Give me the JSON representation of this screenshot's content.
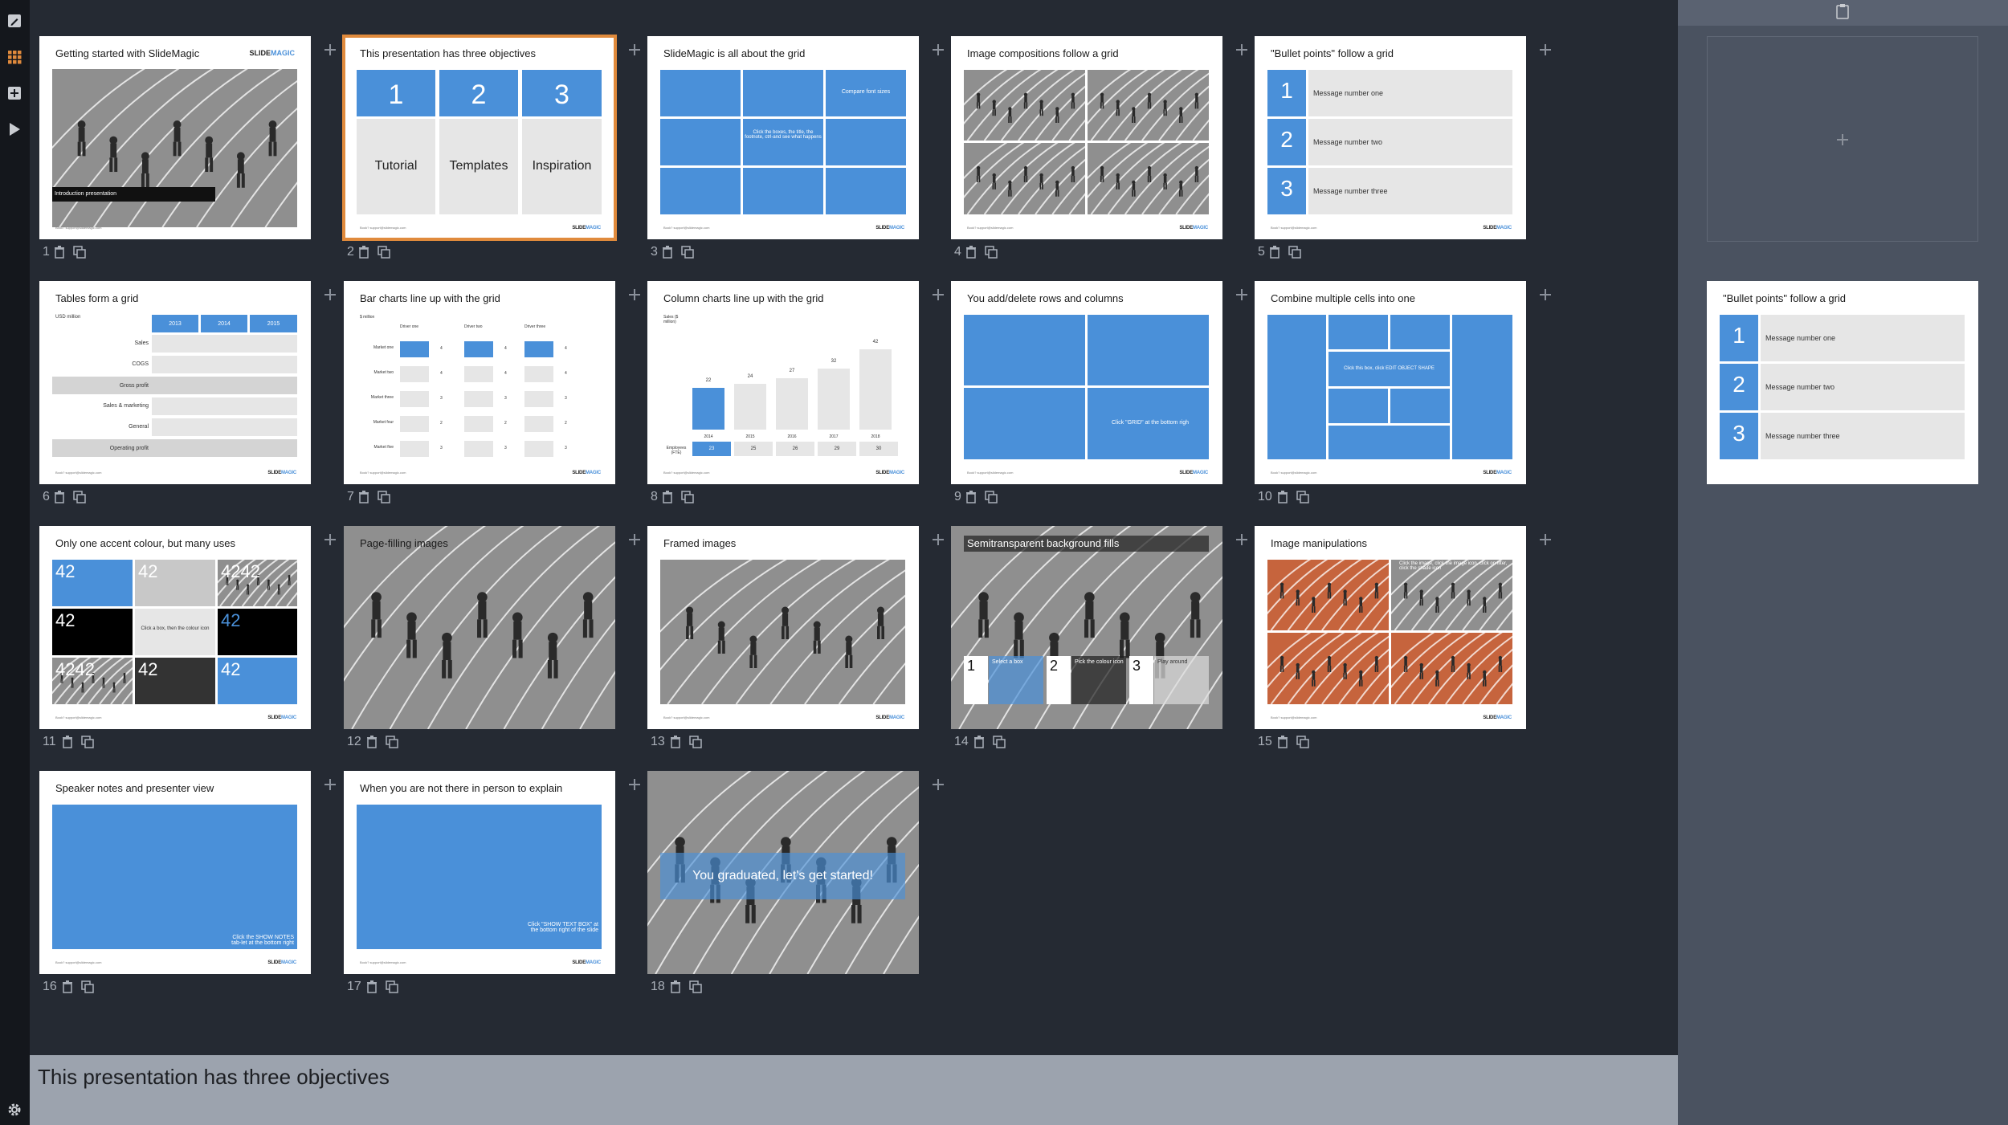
{
  "app": {
    "brand_prefix": "SLIDE",
    "brand_suffix": "MAGIC",
    "footer": "Book? support@slidemagic.com"
  },
  "colors": {
    "accent": "#4a90d9",
    "selected": "#e08a3c",
    "background": "#252a33"
  },
  "sidebar": {
    "items": [
      {
        "icon": "edit-icon"
      },
      {
        "icon": "grid-view-icon"
      },
      {
        "icon": "add-slide-icon"
      },
      {
        "icon": "play-icon"
      }
    ],
    "bottom": {
      "icon": "settings-icon"
    }
  },
  "slides": [
    {
      "number": "1",
      "title": "Getting started with SlideMagic",
      "caption": "Introduction presentation"
    },
    {
      "number": "2",
      "title": "This presentation has three objectives",
      "n1": "1",
      "n2": "2",
      "n3": "3",
      "l1": "Tutorial",
      "l2": "Templates",
      "l3": "Inspiration"
    },
    {
      "number": "3",
      "title": "SlideMagic is all about the grid",
      "t1": "Compare font sizes",
      "t2": "Click the boxes, the title, the footnote, ctrl-and see what happens"
    },
    {
      "number": "4",
      "title": "Image compositions follow a grid"
    },
    {
      "number": "5",
      "title": "\"Bullet points\" follow a grid",
      "m1": "Message number one",
      "m2": "Message number two",
      "m3": "Message number three",
      "n1": "1",
      "n2": "2",
      "n3": "3"
    },
    {
      "number": "6",
      "title": "Tables form a grid",
      "unit": "USD million",
      "cols": [
        "2013",
        "2014",
        "2015"
      ],
      "rows": [
        "Sales",
        "COGS",
        "Gross profit",
        "Sales & marketing",
        "General",
        "Operating profit"
      ]
    },
    {
      "number": "7",
      "title": "Bar charts line up with the grid",
      "unit": "$ million",
      "drivers": [
        "Driver one",
        "Driver two",
        "Driver three"
      ],
      "markets": [
        "Market one",
        "Market two",
        "Market three",
        "Market four",
        "Market five"
      ],
      "vals": [
        [
          "4",
          "4",
          "4"
        ],
        [
          "4",
          "4",
          "4"
        ],
        [
          "3",
          "3",
          "3"
        ],
        [
          "2",
          "2",
          "2"
        ],
        [
          "3",
          "3",
          "3"
        ]
      ]
    },
    {
      "number": "8",
      "title": "Column charts line up with the grid",
      "unit": "Sales ($ million)",
      "years": [
        "2014",
        "2015",
        "2016",
        "2017",
        "2018"
      ],
      "values": [
        "22",
        "24",
        "27",
        "32",
        "42"
      ],
      "emp_label": "Employees (FTE)",
      "emp": [
        "23",
        "25",
        "26",
        "29",
        "30"
      ]
    },
    {
      "number": "9",
      "title": "You add/delete rows and columns",
      "hint": "Click \"GRID\" at the bottom righ"
    },
    {
      "number": "10",
      "title": "Combine multiple cells into one",
      "hint": "Click this box, click EDIT OBJECT SHAPE"
    },
    {
      "number": "11",
      "title": "Only one accent colour, but many uses",
      "v": "42",
      "vv": "4242",
      "hint": "Click a box, then the colour icon"
    },
    {
      "number": "12",
      "title": "Page-filling images"
    },
    {
      "number": "13",
      "title": "Framed images"
    },
    {
      "number": "14",
      "title": "Semitransparent background fills",
      "n1": "1",
      "n2": "2",
      "n3": "3",
      "t1": "Select a box",
      "t2": "Pick the colour icon",
      "t3": "Play around"
    },
    {
      "number": "15",
      "title": "Image manipulations",
      "hint": "Click the image, click the image icon, click on filter, click the shade icon"
    },
    {
      "number": "16",
      "title": "Speaker notes and presenter view",
      "hint": "Click the SHOW NOTES tab-let at the bottom right"
    },
    {
      "number": "17",
      "title": "When you are not there in person to explain",
      "hint": "Click \"SHOW TEXT BOX\" at the bottom right of the slide"
    },
    {
      "number": "18",
      "title": "You graduated, let's get started!"
    }
  ],
  "bottom_bar": {
    "title": "This presentation has three objectives"
  },
  "right_panel": {
    "preview_title": "\"Bullet points\" follow a grid",
    "m1": "Message number one",
    "m2": "Message number two",
    "m3": "Message number three",
    "n1": "1",
    "n2": "2",
    "n3": "3"
  }
}
